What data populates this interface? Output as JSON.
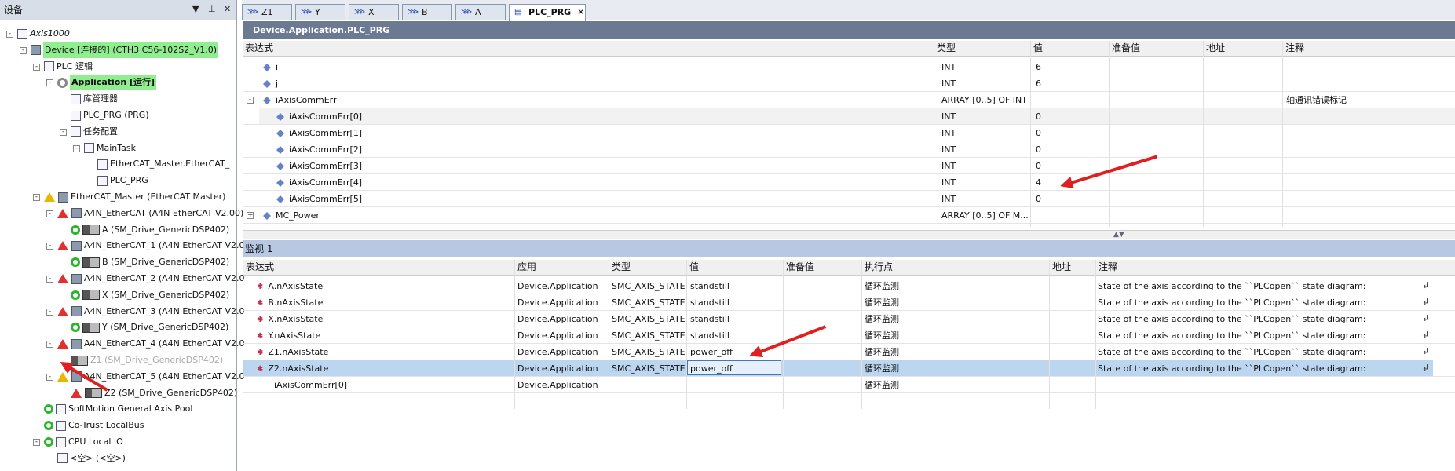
{
  "left_panel": {
    "title": "设备",
    "tree": [
      {
        "label": "Axis1000",
        "level": 0,
        "icon": "project-icon",
        "exp": "-",
        "italic": true
      },
      {
        "label": "Device [连接的] (CTH3 C56-102S2_V1.0)",
        "level": 1,
        "icon": "device-icon",
        "exp": "-",
        "hl": true
      },
      {
        "label": "PLC 逻辑",
        "level": 2,
        "icon": "plc-logic-icon",
        "exp": "-"
      },
      {
        "label": "Application [运行]",
        "level": 3,
        "icon": "application-gear-icon",
        "exp": "-",
        "hl": true,
        "bold": true
      },
      {
        "label": "库管理器",
        "level": 4,
        "icon": "library-icon"
      },
      {
        "label": "PLC_PRG (PRG)",
        "level": 4,
        "icon": "pou-icon"
      },
      {
        "label": "任务配置",
        "level": 4,
        "icon": "task-config-icon",
        "exp": "-"
      },
      {
        "label": "MainTask",
        "level": 5,
        "icon": "task-icon",
        "exp": "-"
      },
      {
        "label": "EtherCAT_Master.EtherCAT_",
        "level": 6,
        "icon": "pou-icon"
      },
      {
        "label": "PLC_PRG",
        "level": 6,
        "icon": "pou-icon"
      },
      {
        "label": "EtherCAT_Master (EtherCAT Master)",
        "level": 2,
        "icon": "ethercat-master-icon",
        "exp": "-",
        "warn": "y"
      },
      {
        "label": "A4N_EtherCAT (A4N EtherCAT V2.00)",
        "level": 3,
        "icon": "slave-icon",
        "exp": "-",
        "warn": "r"
      },
      {
        "label": "A (SM_Drive_GenericDSP402)",
        "level": 4,
        "icon": "drive-icon",
        "ok": true
      },
      {
        "label": "A4N_EtherCAT_1 (A4N EtherCAT V2.0",
        "level": 3,
        "icon": "slave-icon",
        "exp": "-",
        "warn": "r"
      },
      {
        "label": "B (SM_Drive_GenericDSP402)",
        "level": 4,
        "icon": "drive-icon",
        "ok": true
      },
      {
        "label": "A4N_EtherCAT_2 (A4N EtherCAT V2.0",
        "level": 3,
        "icon": "slave-icon",
        "exp": "-",
        "warn": "r"
      },
      {
        "label": "X (SM_Drive_GenericDSP402)",
        "level": 4,
        "icon": "drive-icon",
        "ok": true
      },
      {
        "label": "A4N_EtherCAT_3 (A4N EtherCAT V2.0",
        "level": 3,
        "icon": "slave-icon",
        "exp": "-",
        "warn": "r"
      },
      {
        "label": "Y (SM_Drive_GenericDSP402)",
        "level": 4,
        "icon": "drive-icon",
        "ok": true
      },
      {
        "label": "A4N_EtherCAT_4 (A4N EtherCAT V2.0",
        "level": 3,
        "icon": "slave-icon",
        "exp": "-",
        "warn": "r"
      },
      {
        "label": "Z1 (SM_Drive_GenericDSP402)",
        "level": 4,
        "icon": "drive-icon",
        "dim": true
      },
      {
        "label": "A4N_EtherCAT_5 (A4N EtherCAT V2.0",
        "level": 3,
        "icon": "slave-icon",
        "exp": "-",
        "warn": "y"
      },
      {
        "label": "Z2 (SM_Drive_GenericDSP402)",
        "level": 4,
        "icon": "drive-icon",
        "warn": "r"
      },
      {
        "label": "SoftMotion General Axis Pool",
        "level": 2,
        "icon": "axis-pool-icon",
        "ok": true
      },
      {
        "label": "Co-Trust LocalBus",
        "level": 2,
        "icon": "localbus-icon",
        "ok": true
      },
      {
        "label": "CPU Local IO",
        "level": 2,
        "icon": "local-io-icon",
        "exp": "-",
        "ok": true
      },
      {
        "label": "<空> (<空>)",
        "level": 3,
        "icon": "empty-slot-icon"
      }
    ]
  },
  "tabs": [
    {
      "label": "Z1",
      "active": false
    },
    {
      "label": "Y",
      "active": false
    },
    {
      "label": "X",
      "active": false
    },
    {
      "label": "B",
      "active": false
    },
    {
      "label": "A",
      "active": false
    },
    {
      "label": "PLC_PRG",
      "active": true,
      "close": "✕"
    }
  ],
  "editor": {
    "title": "Device.Application.PLC_PRG",
    "columns": [
      "表达式",
      "类型",
      "值",
      "准备值",
      "地址",
      "注释"
    ],
    "rows": [
      {
        "expr": "i",
        "type": "INT",
        "value": "6",
        "comment": "",
        "indent": 0
      },
      {
        "expr": "j",
        "type": "INT",
        "value": "6",
        "comment": "",
        "indent": 0
      },
      {
        "expr": "iAxisCommErr",
        "type": "ARRAY [0..5] OF INT",
        "value": "",
        "comment": "轴通讯错误标记",
        "indent": 0,
        "exp": "-"
      },
      {
        "expr": "iAxisCommErr[0]",
        "type": "INT",
        "value": "0",
        "comment": "",
        "indent": 1,
        "shaded": true
      },
      {
        "expr": "iAxisCommErr[1]",
        "type": "INT",
        "value": "0",
        "comment": "",
        "indent": 1
      },
      {
        "expr": "iAxisCommErr[2]",
        "type": "INT",
        "value": "0",
        "comment": "",
        "indent": 1
      },
      {
        "expr": "iAxisCommErr[3]",
        "type": "INT",
        "value": "0",
        "comment": "",
        "indent": 1
      },
      {
        "expr": "iAxisCommErr[4]",
        "type": "INT",
        "value": "4",
        "comment": "",
        "indent": 1
      },
      {
        "expr": "iAxisCommErr[5]",
        "type": "INT",
        "value": "0",
        "comment": "",
        "indent": 1
      },
      {
        "expr": "MC_Power",
        "type": "ARRAY [0..5] OF M...",
        "value": "",
        "comment": "",
        "indent": 0,
        "exp": "+"
      }
    ]
  },
  "watch": {
    "title": "监视 1",
    "columns": [
      "表达式",
      "应用",
      "类型",
      "值",
      "准备值",
      "执行点",
      "地址",
      "注释"
    ],
    "rows": [
      {
        "expr": "A.nAxisState",
        "app": "Device.Application",
        "type": "SMC_AXIS_STATE",
        "value": "standstill",
        "exec": "循环监测",
        "comment": "State of the axis according to the ``PLCopen`` state diagram:",
        "ret": "↲"
      },
      {
        "expr": "B.nAxisState",
        "app": "Device.Application",
        "type": "SMC_AXIS_STATE",
        "value": "standstill",
        "exec": "循环监测",
        "comment": "State of the axis according to the ``PLCopen`` state diagram:",
        "ret": "↲"
      },
      {
        "expr": "X.nAxisState",
        "app": "Device.Application",
        "type": "SMC_AXIS_STATE",
        "value": "standstill",
        "exec": "循环监测",
        "comment": "State of the axis according to the ``PLCopen`` state diagram:",
        "ret": "↲"
      },
      {
        "expr": "Y.nAxisState",
        "app": "Device.Application",
        "type": "SMC_AXIS_STATE",
        "value": "standstill",
        "exec": "循环监测",
        "comment": "State of the axis according to the ``PLCopen`` state diagram:",
        "ret": "↲"
      },
      {
        "expr": "Z1.nAxisState",
        "app": "Device.Application",
        "type": "SMC_AXIS_STATE",
        "value": "power_off",
        "exec": "循环监测",
        "comment": "State of the axis according to the ``PLCopen`` state diagram:",
        "ret": "↲"
      },
      {
        "expr": "Z2.nAxisState",
        "app": "Device.Application",
        "type": "SMC_AXIS_STATE",
        "value": "power_off",
        "exec": "循环监测",
        "comment": "State of the axis according to the ``PLCopen`` state diagram:",
        "ret": "↲",
        "selected": true
      },
      {
        "expr": "iAxisCommErr[0]",
        "app": "Device.Application",
        "type": "",
        "value": "",
        "exec": "循环监测",
        "comment": "",
        "ret": ""
      }
    ]
  },
  "colors": {
    "highlight": "#90ee90",
    "panel_header": "#6b7a92",
    "watch_header": "#b8c8e2",
    "selection": "#bcd6f0",
    "annotation_arrow": "#e02020"
  }
}
